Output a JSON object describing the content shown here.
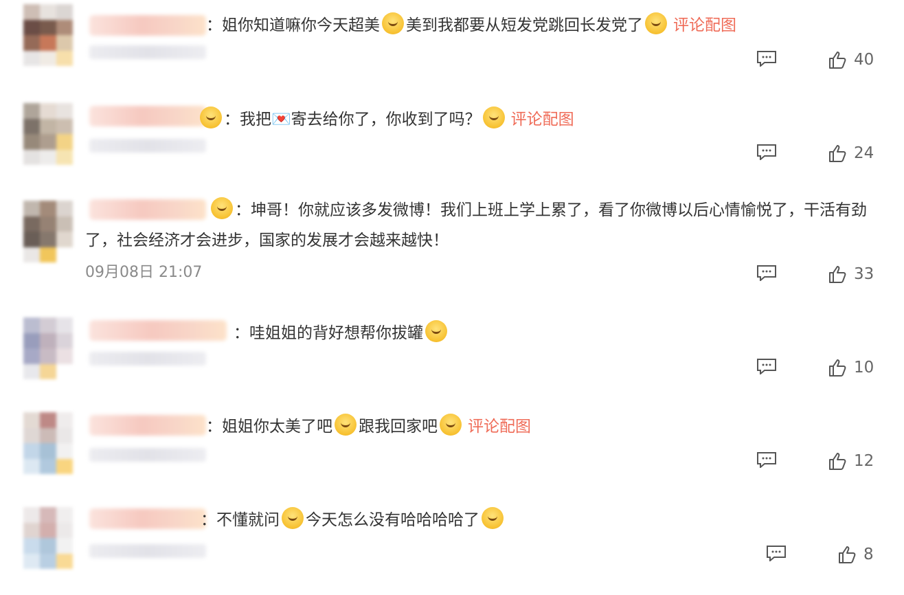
{
  "comments": [
    {
      "parts": [
        "姐你知道嘛你今天超美",
        "美到我都要从短发党跳回长发党了",
        ""
      ],
      "pic_link": "评论配图",
      "likes": "40",
      "time": ""
    },
    {
      "parts": [
        "我把💌寄去给你了，你收到了吗？",
        ""
      ],
      "pic_link": "评论配图",
      "likes": "24",
      "time": ""
    },
    {
      "parts": [
        "坤哥！你就应该多发微博！我们上班上学上累了，看了你微博以后心情愉悦了，干活有劲了，社会经济才会进步，国家的发展才会越来越快！"
      ],
      "pic_link": "",
      "likes": "33",
      "time": "09月08日 21:07"
    },
    {
      "parts": [
        "哇姐姐的背好想帮你拔罐",
        ""
      ],
      "pic_link": "",
      "likes": "10",
      "time": ""
    },
    {
      "parts": [
        "姐姐你太美了吧",
        "跟我回家吧",
        ""
      ],
      "pic_link": "评论配图",
      "likes": "12",
      "time": ""
    },
    {
      "parts": [
        "不懂就问",
        "今天怎么没有哈哈哈哈了",
        ""
      ],
      "pic_link": "",
      "likes": "8",
      "time": ""
    }
  ],
  "icons": {
    "reply": "comment-icon",
    "like": "thumbs-up-icon",
    "emoji": "emoji-face-icon"
  },
  "colors": {
    "text": "#333333",
    "link": "#ef6b57",
    "meta": "#8a8a8a",
    "count": "#666666",
    "icon": "#555555"
  }
}
